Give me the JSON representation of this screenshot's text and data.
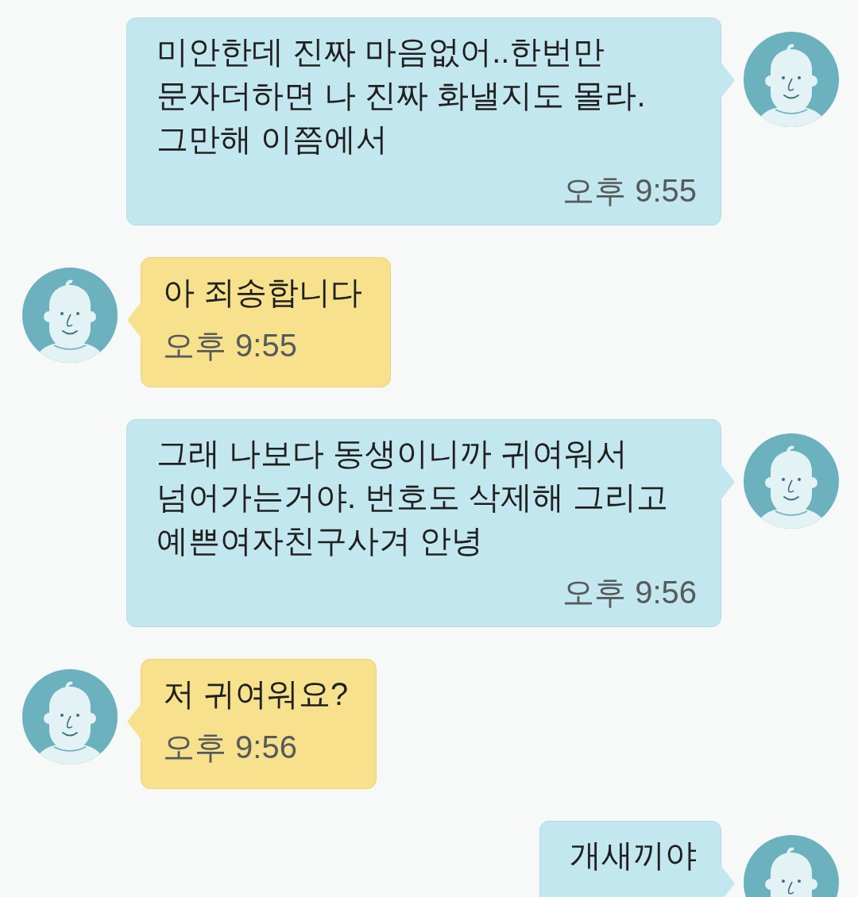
{
  "messages": [
    {
      "kind": "sent",
      "text": "미안한데 진짜 마음없어..한번만\n문자더하면 나 진짜 화낼지도 몰라.\n그만해 이쯤에서",
      "time": "오후 9:55"
    },
    {
      "kind": "received",
      "text": "아 죄송합니다",
      "time": "오후 9:55"
    },
    {
      "kind": "sent",
      "text": "그래 나보다 동생이니까 귀여워서\n넘어가는거야. 번호도 삭제해 그리고\n예쁜여자친구사겨 안녕",
      "time": "오후 9:56"
    },
    {
      "kind": "received",
      "text": "저 귀여워요?",
      "time": "오후 9:56"
    },
    {
      "kind": "sent",
      "text": "개새끼야"
    }
  ]
}
